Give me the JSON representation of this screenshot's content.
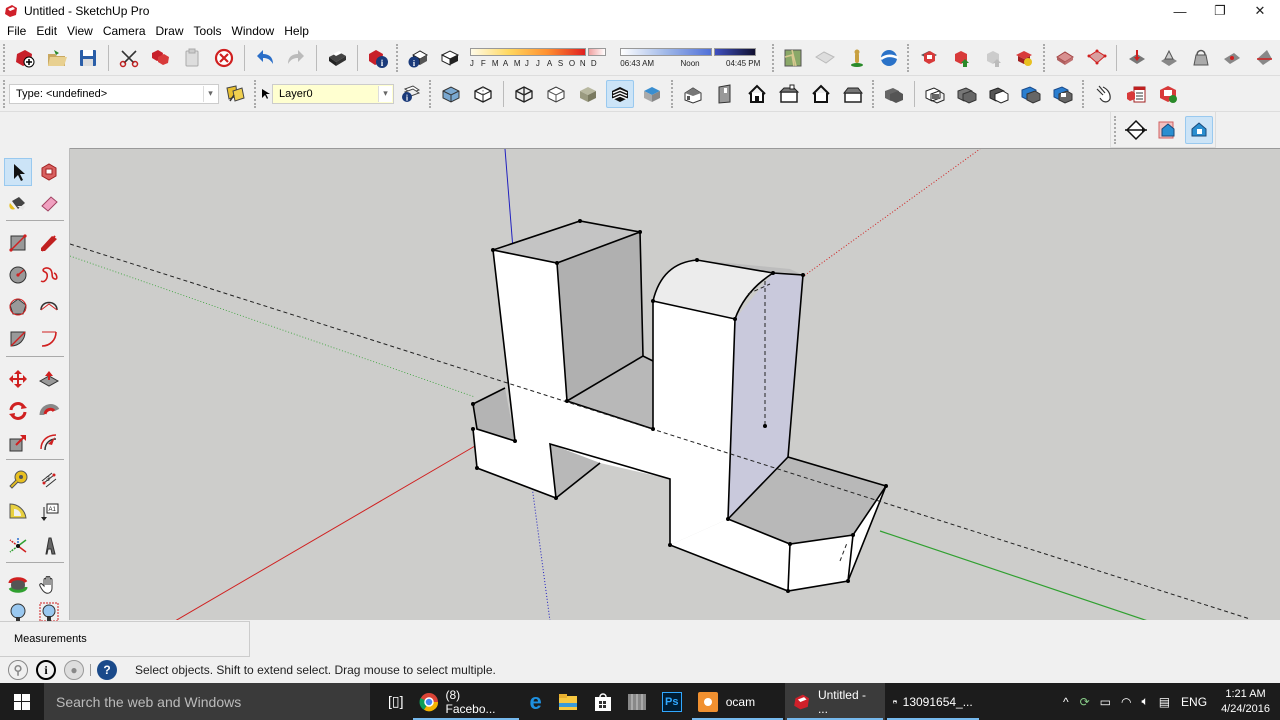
{
  "window": {
    "title": "Untitled - SketchUp Pro",
    "controls": {
      "minimize": "—",
      "restore": "❐",
      "close": "✕"
    }
  },
  "menu": [
    "File",
    "Edit",
    "View",
    "Camera",
    "Draw",
    "Tools",
    "Window",
    "Help"
  ],
  "toolbar_row1": {
    "standard": [
      "new-icon",
      "open-icon",
      "save-icon",
      "cut-icon",
      "copy-icon",
      "paste-icon",
      "erase-icon",
      "undo-icon",
      "redo-icon",
      "print-icon",
      "model-info-icon"
    ],
    "shadows": {
      "icons": [
        "shadow-settings-icon",
        "display-shadows-icon"
      ],
      "months": [
        "J",
        "F",
        "M",
        "A",
        "M",
        "J",
        "J",
        "A",
        "S",
        "O",
        "N",
        "D"
      ],
      "time_start": "06:43 AM",
      "time_mid": "Noon",
      "time_end": "04:45 PM",
      "month_value": 11,
      "time_value_fraction": 0.89
    },
    "location": [
      "add-location-icon",
      "toggle-terrain-icon",
      "photo-textures-icon",
      "google-earth-icon"
    ],
    "warehouse": [
      "3d-warehouse-icon",
      "share-model-icon",
      "share-component-icon",
      "extension-warehouse-icon"
    ],
    "sandbox": [
      "smoove-icon",
      "stamp-icon",
      "drape-icon",
      "add-detail-icon",
      "flip-edge-icon",
      "from-contours-icon"
    ]
  },
  "toolbar_row2": {
    "measurements_type": "Type: <undefined>",
    "layer": "Layer0",
    "styles": [
      "xray-icon",
      "back-edges-icon",
      "wireframe-icon",
      "hidden-line-icon",
      "shaded-icon",
      "shaded-textures-icon",
      "monochrome-icon"
    ],
    "views": [
      "iso-view-icon",
      "top-view-icon",
      "front-view-icon",
      "right-view-icon",
      "back-view-icon",
      "left-view-icon"
    ],
    "solid_tools": [
      "outer-shell-icon",
      "intersect-icon",
      "union-icon",
      "subtract-icon",
      "trim-icon",
      "split-icon"
    ],
    "extras": [
      "interact-icon",
      "dynamic-components-options-icon",
      "dynamic-components-attributes-icon"
    ]
  },
  "toolbar_row3": [
    "section-plane-icon",
    "display-section-planes-icon",
    "display-section-cuts-icon"
  ],
  "left_tools": [
    "select-icon",
    "make-component-icon",
    "paint-bucket-icon",
    "eraser-icon",
    "rectangle-icon",
    "line-icon",
    "circle-icon",
    "freehand-icon",
    "polygon-icon",
    "arc-icon",
    "pie-icon",
    "two-point-arc-icon",
    "move-icon",
    "push-pull-icon",
    "rotate-icon",
    "follow-me-icon",
    "scale-icon",
    "offset-icon",
    "tape-measure-icon",
    "dimension-icon",
    "protractor-icon",
    "text-icon",
    "axes-icon",
    "3d-text-icon",
    "orbit-icon",
    "pan-icon",
    "zoom-icon",
    "zoom-window-icon"
  ],
  "measurements_label": "Measurements",
  "status": {
    "message": "Select objects. Shift to extend select. Drag mouse to select multiple.",
    "icons": [
      "geo-location-icon",
      "credits-icon",
      "sign-in-icon",
      "help-icon"
    ]
  },
  "taskbar": {
    "search_placeholder": "Search the web and Windows",
    "apps": [
      {
        "name": "chrome",
        "label": "(8) Facebo..."
      },
      {
        "name": "edge",
        "label": ""
      },
      {
        "name": "file-explorer",
        "label": ""
      },
      {
        "name": "store",
        "label": ""
      },
      {
        "name": "unknown-app",
        "label": ""
      },
      {
        "name": "photoshop",
        "label": ""
      },
      {
        "name": "ocam",
        "label": "ocam"
      },
      {
        "name": "sketchup",
        "label": "Untitled - ..."
      },
      {
        "name": "photos",
        "label": "13091654_..."
      }
    ],
    "language": "ENG",
    "time": "1:21 AM",
    "date": "4/24/2016"
  },
  "colors": {
    "viewport_bg": "#cdcdcb",
    "axis_red": "#d02020",
    "axis_green": "#30a030",
    "axis_blue": "#2020c0",
    "selection_blue": "#cce4f7"
  }
}
